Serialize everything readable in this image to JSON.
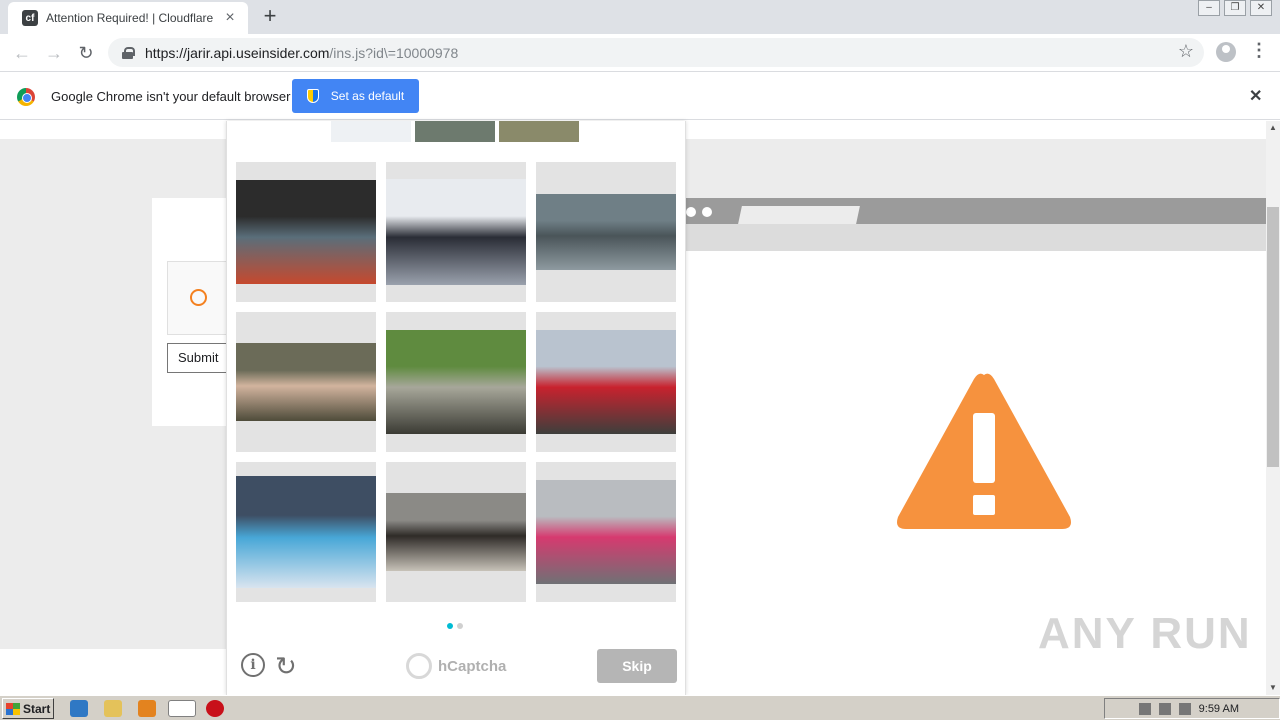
{
  "browser": {
    "tab_title": "Attention Required! | Cloudflare",
    "tab_favicon": "cloudflare-favicon",
    "url_host": "https://jarir.api.useinsider.com",
    "url_path": "/ins.js?id\\=10000978"
  },
  "infobar": {
    "message": "Google Chrome isn't your default browser",
    "button_label": "Set as default"
  },
  "page": {
    "submit_label": "Submit",
    "warning_color": "#f6923e",
    "watermark": "ANY RUN"
  },
  "captcha": {
    "example_images": [
      "example-1",
      "example-2",
      "example-3"
    ],
    "grid": [
      {
        "name": "dragon-boat-rowers-image",
        "colors": [
          "#2c2c2c",
          "#5a6e7a",
          "#c6492e"
        ],
        "img_h": 104
      },
      {
        "name": "motorcycle-closeup-image",
        "colors": [
          "#e8ebef",
          "#2a2d36",
          "#9aa1ad"
        ],
        "img_h": 106
      },
      {
        "name": "fighter-jet-carrier-image",
        "colors": [
          "#6f7f86",
          "#4a5559",
          "#8e9aa0"
        ],
        "img_h": 76
      },
      {
        "name": "soldier-blurred-face-image",
        "colors": [
          "#6b6b58",
          "#d2b49e",
          "#4e4b3a"
        ],
        "img_h": 78
      },
      {
        "name": "vintage-bus-image",
        "colors": [
          "#5f8b3f",
          "#a7a79a",
          "#3b3b34"
        ],
        "img_h": 104
      },
      {
        "name": "red-white-airplane-image",
        "colors": [
          "#b9c3cf",
          "#c8222e",
          "#3d3f3c"
        ],
        "img_h": 104
      },
      {
        "name": "aerobatic-plane-image",
        "colors": [
          "#3e4e63",
          "#48a7d7",
          "#d9e4ef"
        ],
        "img_h": 112
      },
      {
        "name": "street-bus-japan-image",
        "colors": [
          "#8b8a86",
          "#2f2b28",
          "#c7c2b8"
        ],
        "img_h": 78
      },
      {
        "name": "pink-stripe-train-image",
        "colors": [
          "#b9bcc0",
          "#d63a6f",
          "#6f7175"
        ],
        "img_h": 104
      }
    ],
    "brand": "hCaptcha",
    "skip_label": "Skip",
    "accent_color": "#00bcd4"
  },
  "taskbar": {
    "start_label": "Start",
    "clock": "9:59 AM"
  }
}
